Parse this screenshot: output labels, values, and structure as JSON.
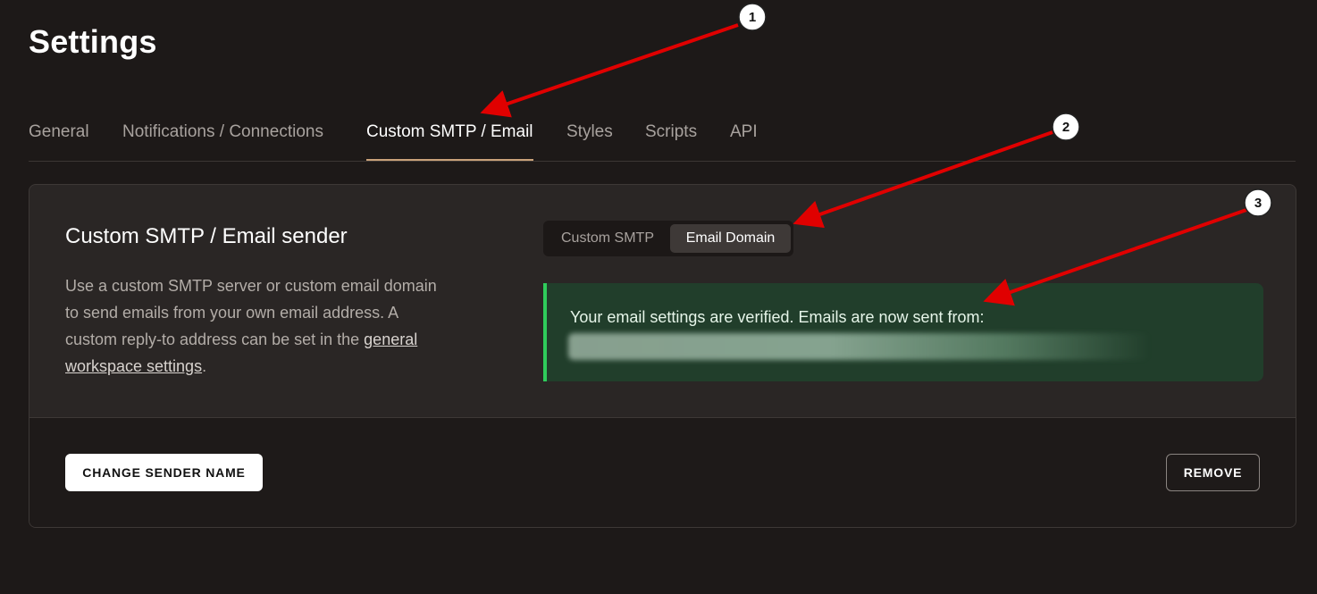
{
  "page": {
    "title": "Settings"
  },
  "tabs": [
    {
      "label": "General",
      "active": false
    },
    {
      "label": "Notifications / Connections",
      "active": false
    },
    {
      "label": "Custom SMTP / Email",
      "active": true
    },
    {
      "label": "Styles",
      "active": false
    },
    {
      "label": "Scripts",
      "active": false
    },
    {
      "label": "API",
      "active": false
    }
  ],
  "section": {
    "title": "Custom SMTP / Email sender",
    "description_before_link": "Use a custom SMTP server or custom email domain to send emails from your own email address. A custom reply-to address can be set in the ",
    "link_text": "general workspace settings",
    "description_after_link": "."
  },
  "toggle": {
    "options": [
      "Custom SMTP",
      "Email Domain"
    ],
    "selected": "Email Domain"
  },
  "alert": {
    "message": "Your email settings are verified. Emails are now sent from:"
  },
  "buttons": {
    "change_sender": "CHANGE SENDER NAME",
    "remove": "REMOVE"
  },
  "annotations": {
    "badges": [
      "1",
      "2",
      "3"
    ]
  },
  "colors": {
    "background": "#1d1918",
    "card": "#2a2625",
    "active_tab_underline": "#c9a27a",
    "success_bg": "#213e2b",
    "success_accent": "#2fcc5b",
    "annotation_arrow": "#e00000"
  }
}
